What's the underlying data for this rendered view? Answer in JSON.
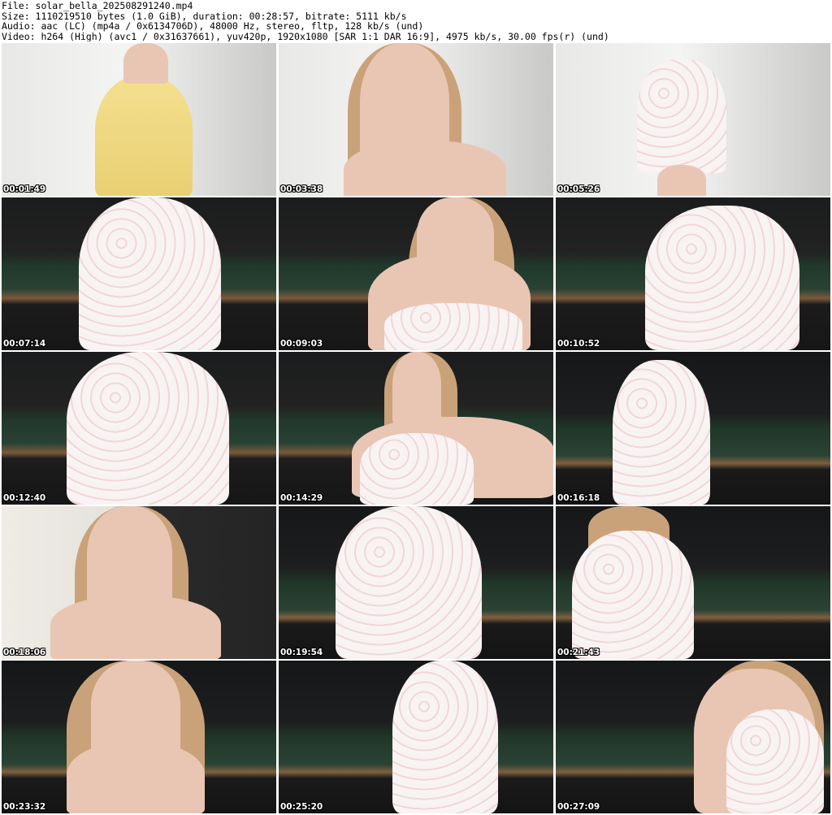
{
  "header": {
    "line1": "File: solar_bella_202508291240.mp4",
    "line2": "Size: 1110219510 bytes (1.0 GiB), duration: 00:28:57, bitrate: 5111 kb/s",
    "line3": "Audio: aac (LC) (mp4a / 0x6134706D), 48000 Hz, stereo, fltp, 128 kb/s (und)",
    "line4": "Video: h264 (High) (avc1 / 0x31637661), yuv420p, 1920x1080 [SAR 1:1 DAR 16:9], 4975 kb/s, 30.00 fps(r) (und)"
  },
  "thumbnails": [
    {
      "time": "00:01:49"
    },
    {
      "time": "00:03:38"
    },
    {
      "time": "00:05:26"
    },
    {
      "time": "00:07:14"
    },
    {
      "time": "00:09:03"
    },
    {
      "time": "00:10:52"
    },
    {
      "time": "00:12:40"
    },
    {
      "time": "00:14:29"
    },
    {
      "time": "00:16:18"
    },
    {
      "time": "00:18:06"
    },
    {
      "time": "00:19:54"
    },
    {
      "time": "00:21:43"
    },
    {
      "time": "00:23:32"
    },
    {
      "time": "00:25:20"
    },
    {
      "time": "00:27:09"
    }
  ]
}
